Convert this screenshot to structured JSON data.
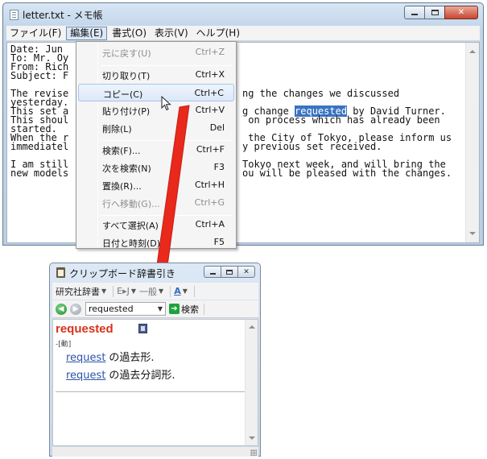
{
  "notepad": {
    "title": "letter.txt - メモ帳",
    "menus": [
      "ファイル(F)",
      "編集(E)",
      "書式(O)",
      "表示(V)",
      "ヘルプ(H)"
    ],
    "active_menu": "編集(E)",
    "lines": [
      {
        "left": "Date: Jun",
        "right": ""
      },
      {
        "left": "To: Mr. Oy",
        "right": ""
      },
      {
        "left": "From: Rich",
        "right": ""
      },
      {
        "left": "Subject: F",
        "right": ""
      },
      {
        "left": "",
        "right": ""
      },
      {
        "left": "The revise",
        "right": "ng the changes we discussed"
      },
      {
        "left": "yesterday.",
        "right": ""
      },
      {
        "left": "This set a",
        "right": "g change ",
        "selected": "requested",
        "after": " by David Turner."
      },
      {
        "left": "This shoul",
        "right": " on process which has already been"
      },
      {
        "left": "started.",
        "right": ""
      },
      {
        "left": "When the r",
        "right": " the City of Tokyo, please inform us"
      },
      {
        "left": "immediatel",
        "right": "y previous set received."
      },
      {
        "left": "",
        "right": ""
      },
      {
        "left": "I am still",
        "right": "Tokyo next week, and will bring the"
      },
      {
        "left": "new models",
        "right": "ou will be pleased with the changes."
      }
    ]
  },
  "edit_menu": {
    "items": [
      {
        "label": "元に戻す(U)",
        "shortcut": "Ctrl+Z",
        "disabled": true
      },
      {
        "label": "切り取り(T)",
        "shortcut": "Ctrl+X"
      },
      {
        "label": "コピー(C)",
        "shortcut": "Ctrl+C",
        "highlighted": true
      },
      {
        "label": "貼り付け(P)",
        "shortcut": "Ctrl+V"
      },
      {
        "label": "削除(L)",
        "shortcut": "Del"
      },
      {
        "label": "検索(F)...",
        "shortcut": "Ctrl+F"
      },
      {
        "label": "次を検索(N)",
        "shortcut": "F3"
      },
      {
        "label": "置換(R)...",
        "shortcut": "Ctrl+H"
      },
      {
        "label": "行へ移動(G)...",
        "shortcut": "Ctrl+G",
        "disabled": true
      },
      {
        "label": "すべて選択(A)",
        "shortcut": "Ctrl+A"
      },
      {
        "label": "日付と時刻(D)",
        "shortcut": "F5"
      }
    ]
  },
  "clip_dict": {
    "title": "クリップボード辞書引き",
    "toolbar1": {
      "dictionary": "研究社辞書",
      "lang": "E▸J",
      "mode": "一般",
      "font_btn": "A"
    },
    "toolbar2": {
      "search_value": "requested",
      "search_button": "検索"
    },
    "headword": "requested",
    "pos": "-[動]",
    "definitions": [
      {
        "link": "request",
        "text": "の過去形."
      },
      {
        "link": "request",
        "text": "の過去分詞形."
      }
    ]
  },
  "colors": {
    "accent_red": "#e8291c",
    "headword": "#d8331d",
    "selection": "#3a73c2",
    "link": "#2c56a8"
  }
}
